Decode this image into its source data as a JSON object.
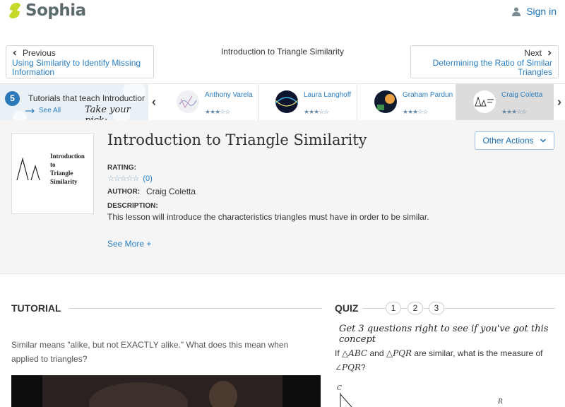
{
  "brand": {
    "name": "Sophia",
    "signin": "Sign in"
  },
  "nav": {
    "prev_label": "Previous",
    "prev_title": "Using Similarity to Identify Missing Information",
    "center_title": "Introduction to Triangle Similarity",
    "next_label": "Next",
    "next_title": "Determining the Ratio of Similar Triangles"
  },
  "tutorials": {
    "count": "5",
    "label": "Tutorials that teach Introduction to Triangle Similarity",
    "see_all": "See All",
    "pick": "Take your pick:",
    "cards": [
      {
        "name": "Anthony Varela",
        "stars": "★★★☆☆"
      },
      {
        "name": "Laura Langhoff",
        "stars": "★★★☆☆"
      },
      {
        "name": "Graham Pardun",
        "stars": "★★★☆☆"
      },
      {
        "name": "Craig Coletta",
        "stars": "★★★☆☆"
      }
    ]
  },
  "lesson": {
    "thumb_text": [
      "Introduction",
      "to",
      "Triangle",
      "Similarity"
    ],
    "title": "Introduction to Triangle Similarity",
    "other_actions": "Other Actions",
    "rating_label": "RATING:",
    "rating_stars": "☆☆☆☆☆",
    "rating_count": "(0)",
    "author_label": "AUTHOR:",
    "author": "Craig Coletta",
    "description_label": "DESCRIPTION:",
    "description": "This lesson will introduce the characteristics triangles must have in order to be similar.",
    "see_more": "See More +"
  },
  "tutorial": {
    "heading": "TUTORIAL",
    "text": "Similar means \"alike, but not EXACTLY alike.\" What does this mean when applied to triangles?"
  },
  "quiz": {
    "heading": "QUIZ",
    "numbers": [
      "1",
      "2",
      "3"
    ],
    "hint": "Get 3 questions right to see if you've got this concept",
    "q_prefix": "If",
    "tri1": "△ABC",
    "q_and": "and",
    "tri2": "△PQR",
    "q_mid": "are similar, what is the measure of",
    "angle": "∠PQR",
    "q_end": "?",
    "fig_c": "C",
    "fig_r": "R"
  }
}
